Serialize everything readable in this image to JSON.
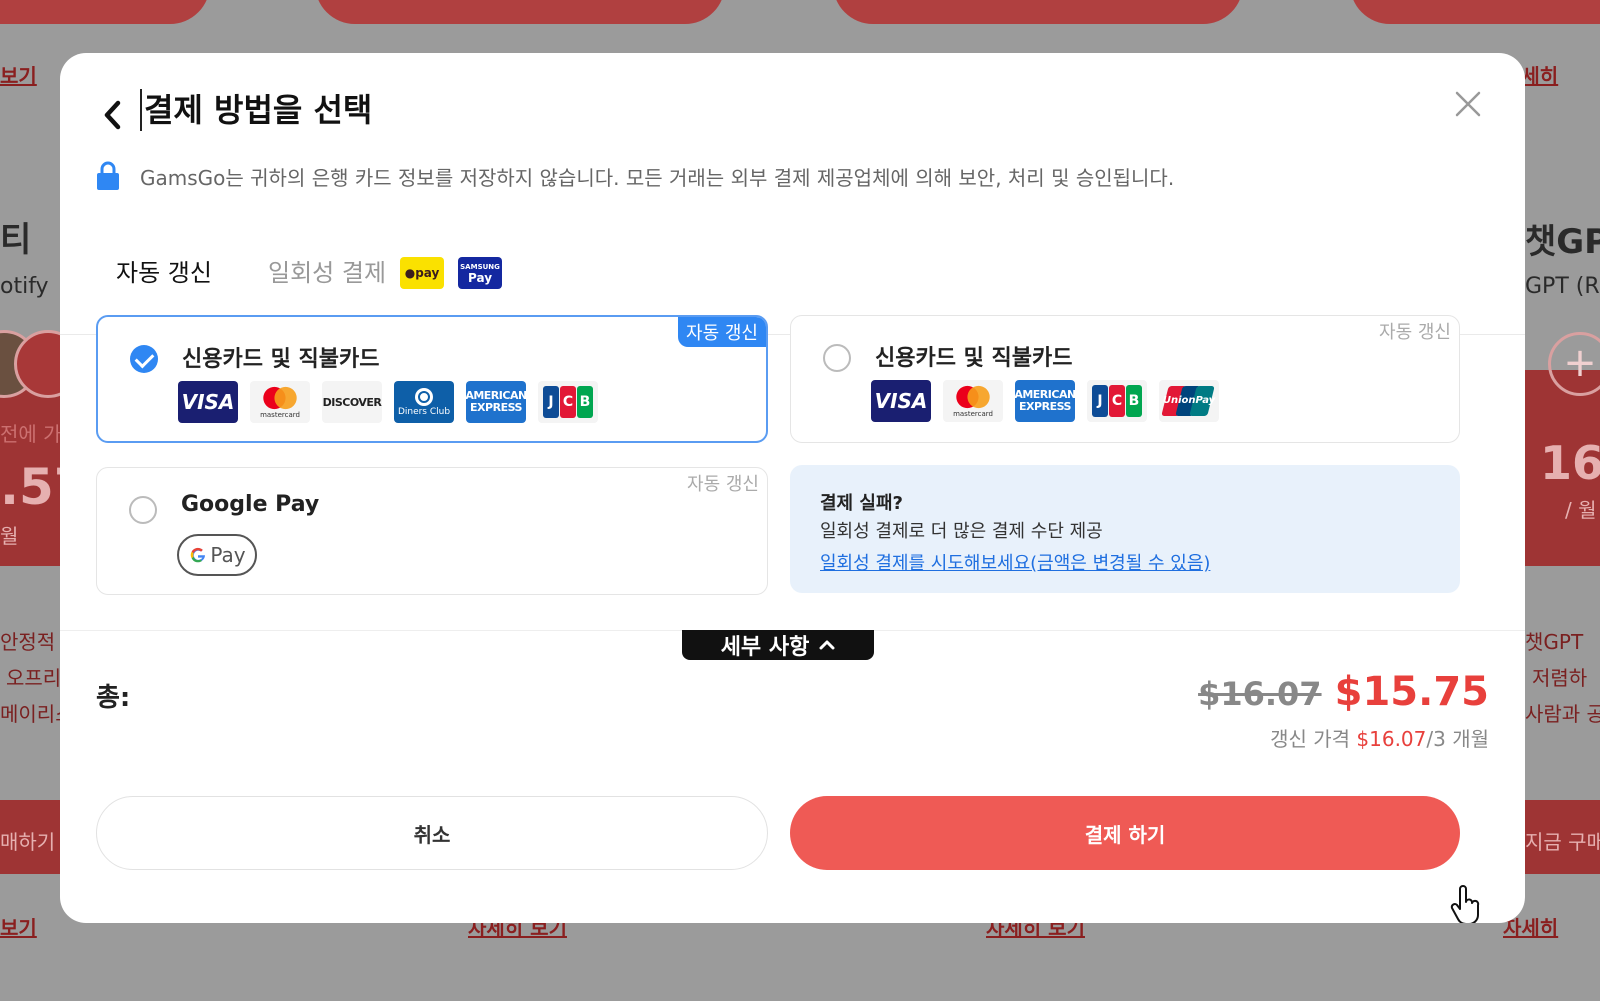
{
  "background": {
    "links": [
      "보기",
      "자세히 보기",
      "자세히 보기",
      "자세히",
      "보기",
      "자세히"
    ],
    "left_texts": [
      "티",
      "otify",
      "전에 가",
      ".57",
      "월",
      "안정적",
      "오프리",
      "메이리스",
      "매하기"
    ],
    "right_texts": [
      "챗GP",
      "GPT (R",
      "16.",
      "/ 월",
      "챗GPT",
      "저렴하",
      "사람과 공",
      "지금 구매"
    ]
  },
  "modal": {
    "title": "결제 방법을 선택",
    "security_note": "GamsGo는 귀하의 은행 카드 정보를 저장하지 않습니다. 모든 거래는 외부 결제 제공업체에 의해 보안, 처리 및 승인됩니다.",
    "tabs": [
      {
        "label": "자동 갱신",
        "active": true
      },
      {
        "label": "일회성 결제",
        "active": false
      }
    ],
    "badges": {
      "kakao": "pay",
      "samsung_top": "SAMSUNG",
      "samsung_bottom": "Pay"
    },
    "options": [
      {
        "label": "신용카드 및 직불카드",
        "tag": "자동 갱신",
        "selected": true,
        "cards": [
          "VISA",
          "mastercard",
          "DISCOVER",
          "Diners Club",
          "AMERICAN EXPRESS",
          "JCB"
        ]
      },
      {
        "label": "신용카드 및 직불카드",
        "tag": "자동 갱신",
        "selected": false,
        "cards": [
          "VISA",
          "mastercard",
          "AMERICAN EXPRESS",
          "JCB",
          "UnionPay"
        ]
      },
      {
        "label": "Google Pay",
        "tag": "자동 갱신",
        "selected": false,
        "pill": "Pay"
      }
    ],
    "fail_box": {
      "title": "결제 실패?",
      "description": "일회성 결제로 더 많은 결제 수단 제공",
      "link": "일회성 결제를 시도해보세요(금액은 변경될 수 있음)"
    },
    "details_label": "세부 사항",
    "total_label": "총:",
    "price_old": "$16.07",
    "price_new": "$15.75",
    "renew_prefix": "갱신 가격",
    "renew_price": "$16.07",
    "renew_suffix": "/3 개월",
    "cancel_label": "취소",
    "pay_label": "결제 하기"
  },
  "colors": {
    "accent_blue": "#2f87f3",
    "price_red": "#e8403c",
    "pay_button": "#ef5a55"
  }
}
